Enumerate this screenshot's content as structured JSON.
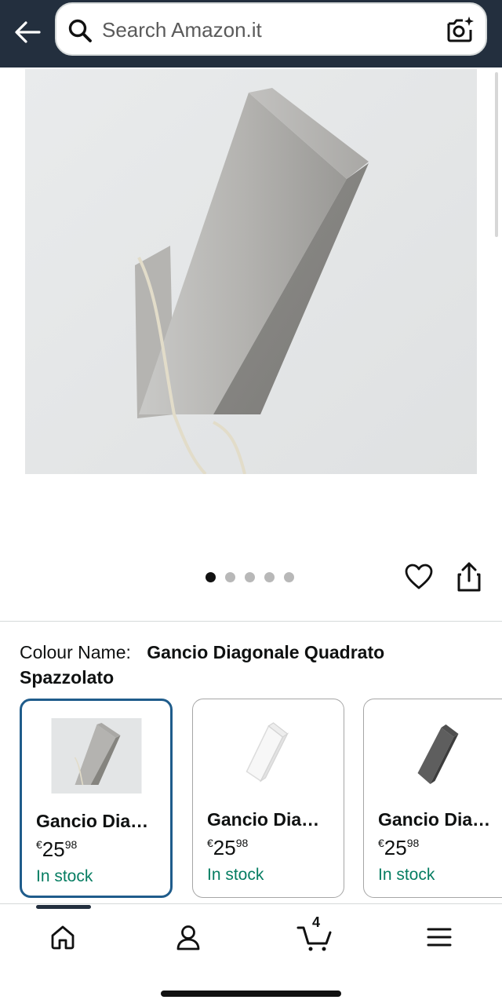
{
  "header": {
    "back_icon": "arrow-left-icon",
    "search_placeholder": "Search Amazon.it",
    "camera_icon": "camera-search-icon",
    "bg_color": "#232F3E"
  },
  "product": {
    "image_alt": "Gancio Diagonale Quadrato Spazzolato",
    "carousel": {
      "total": 5,
      "active": 1
    },
    "wishlist_icon": "heart-icon",
    "share_icon": "share-icon"
  },
  "colour": {
    "label": "Colour Name:",
    "value": "Gancio Diagonale Quadrato Spazzolato"
  },
  "variants": [
    {
      "title": "Gancio Dia…",
      "currency": "€",
      "whole": "25",
      "fraction": "98",
      "stock": "In stock",
      "selected": true
    },
    {
      "title": "Gancio Dia…",
      "currency": "€",
      "whole": "25",
      "fraction": "98",
      "stock": "In stock",
      "selected": false
    },
    {
      "title": "Gancio Dia…",
      "currency": "€",
      "whole": "25",
      "fraction": "98",
      "stock": "In stock",
      "selected": false
    }
  ],
  "nav": {
    "items": [
      "home-icon",
      "account-icon",
      "cart-icon",
      "menu-icon"
    ],
    "cart_count": "4"
  },
  "colors": {
    "accent_selected": "#1f5c8b",
    "in_stock": "#067D62"
  }
}
